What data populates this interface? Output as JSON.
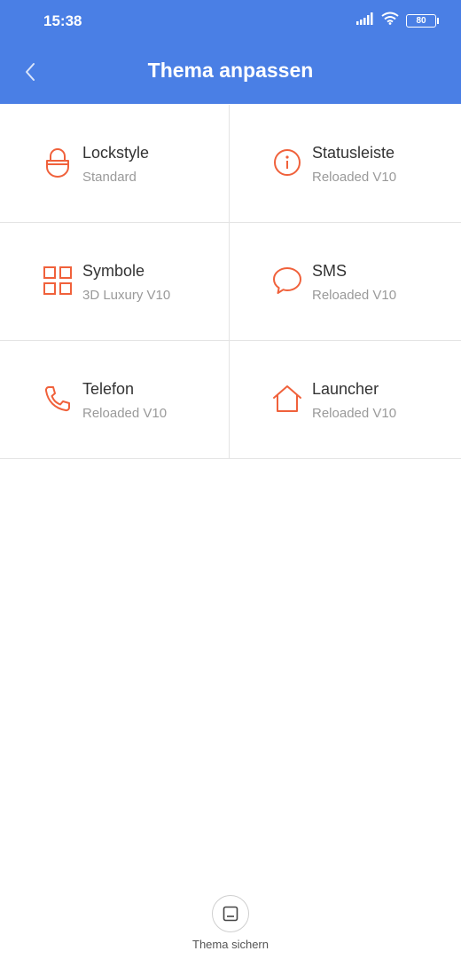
{
  "status_bar": {
    "time": "15:38",
    "battery": "80",
    "icons": [
      "signal-icon",
      "wifi-icon",
      "battery-icon"
    ]
  },
  "header": {
    "title": "Thema anpassen",
    "back_icon": "chevron-left-icon"
  },
  "colors": {
    "appbar": "#4a7fe5",
    "accent": "#f0613b",
    "title_text": "#333333",
    "subtitle_text": "#9a9a9a"
  },
  "modules": [
    {
      "label": "Lockstyle",
      "value": "Standard",
      "icon": "lock-icon"
    },
    {
      "label": "Statusleiste",
      "value": "Reloaded V10",
      "icon": "info-icon"
    },
    {
      "label": "Symbole",
      "value": "3D Luxury V10",
      "icon": "grid-icon"
    },
    {
      "label": "SMS",
      "value": "Reloaded V10",
      "icon": "chat-bubble-icon"
    },
    {
      "label": "Telefon",
      "value": "Reloaded V10",
      "icon": "phone-icon"
    },
    {
      "label": "Launcher",
      "value": "Reloaded V10",
      "icon": "home-icon"
    }
  ],
  "footer": {
    "save_label": "Thema sichern",
    "save_icon": "save-theme-icon"
  }
}
